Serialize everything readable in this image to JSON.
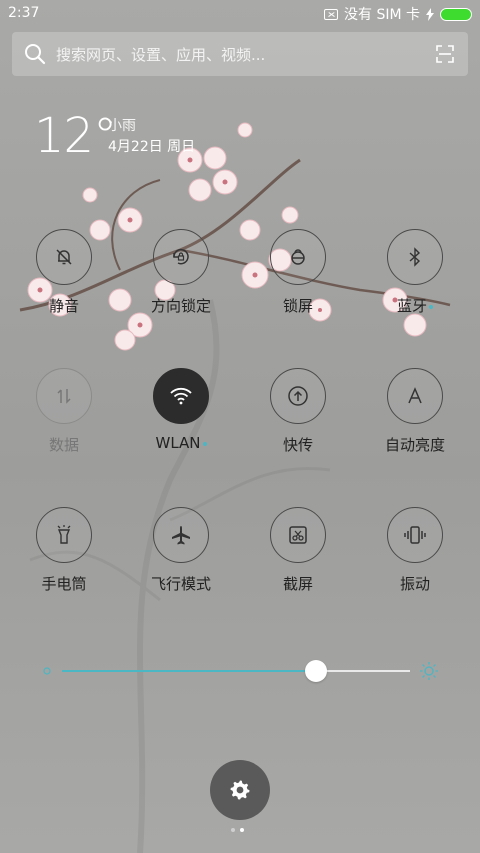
{
  "status_bar": {
    "time": "2:37",
    "carrier": "没有 SIM 卡",
    "battery_color": "#3ddc2f"
  },
  "search": {
    "placeholder": "搜索网页、设置、应用、视频...",
    "icons": [
      "search-icon",
      "scan-icon"
    ]
  },
  "weather": {
    "temperature": "12°",
    "condition": "小雨",
    "date": "4月22日 周日"
  },
  "tiles": [
    {
      "label": "静音",
      "icon": "bell-off-icon",
      "state": "off"
    },
    {
      "label": "方向锁定",
      "icon": "rotation-lock-icon",
      "state": "off"
    },
    {
      "label": "锁屏",
      "icon": "lock-icon",
      "state": "off"
    },
    {
      "label": "蓝牙",
      "icon": "bluetooth-icon",
      "state": "off"
    },
    {
      "label": "数据",
      "icon": "data-arrows-icon",
      "state": "disabled"
    },
    {
      "label": "WLAN",
      "icon": "wifi-icon",
      "state": "on"
    },
    {
      "label": "快传",
      "icon": "upload-icon",
      "state": "off"
    },
    {
      "label": "自动亮度",
      "icon": "auto-brightness-icon",
      "state": "off"
    },
    {
      "label": "手电筒",
      "icon": "flashlight-icon",
      "state": "off"
    },
    {
      "label": "飞行模式",
      "icon": "airplane-icon",
      "state": "off"
    },
    {
      "label": "截屏",
      "icon": "screenshot-icon",
      "state": "off"
    },
    {
      "label": "振动",
      "icon": "vibrate-icon",
      "state": "off"
    }
  ],
  "brightness": {
    "level": 0.73,
    "accent": "#4bb6c4"
  },
  "pager": {
    "pages": 2,
    "current": 1
  }
}
